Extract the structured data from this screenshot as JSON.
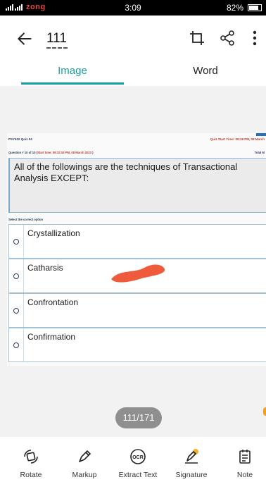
{
  "status_bar": {
    "carrier": "zong",
    "time": "3:09",
    "battery": "82%"
  },
  "header": {
    "title": "111",
    "tabs": [
      {
        "label": "Image"
      },
      {
        "label": "Word"
      }
    ]
  },
  "document": {
    "quiz_title": "PSY632 Quiz 04",
    "quiz_start": "Quiz Start Time: 09:28 PM, 08 March",
    "question_number": "Question # 10 of 10 (",
    "question_start": "Start time: 09:32:53 PM, 08 March 2023",
    "question_close": " )",
    "total_marks": "Total M",
    "question_text": "All of the followings are the techniques of Transactional Analysis EXCEPT:",
    "select_label": "Select the correct option",
    "options": [
      {
        "label": "Crystallization"
      },
      {
        "label": "Catharsis"
      },
      {
        "label": "Confrontation"
      },
      {
        "label": "Confirmation"
      }
    ]
  },
  "page_counter": "111/171",
  "toolbar": [
    {
      "label": "Rotate",
      "icon": "rotate-icon"
    },
    {
      "label": "Markup",
      "icon": "markup-icon"
    },
    {
      "label": "Extract Text",
      "icon": "ocr-icon"
    },
    {
      "label": "Signature",
      "icon": "signature-icon"
    },
    {
      "label": "Note",
      "icon": "note-icon"
    }
  ],
  "colors": {
    "accent": "#1a9ba0",
    "redaction": "#f05a3c"
  }
}
